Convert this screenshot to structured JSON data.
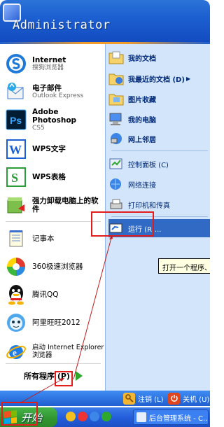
{
  "header": {
    "user_name": "Administrator"
  },
  "left_items": [
    {
      "title": "Internet",
      "subtitle": "搜狗浏览器",
      "icon": "sogou-browser-icon"
    },
    {
      "title": "电子邮件",
      "subtitle": "Outlook Express",
      "icon": "outlook-express-icon"
    },
    {
      "title": "Adobe Photoshop",
      "subtitle": "CS5",
      "icon": "photoshop-icon"
    },
    {
      "title": "WPS文字",
      "subtitle": "",
      "icon": "wps-writer-icon"
    },
    {
      "title": "WPS表格",
      "subtitle": "",
      "icon": "wps-spreadsheet-icon"
    },
    {
      "title": "强力卸载电脑上的软件",
      "subtitle": "",
      "icon": "uninstaller-icon"
    },
    {
      "title": "记事本",
      "subtitle": "",
      "icon": "notepad-icon"
    },
    {
      "title": "360极速浏览器",
      "subtitle": "",
      "icon": "360-browser-icon"
    },
    {
      "title": "腾讯QQ",
      "subtitle": "",
      "icon": "qq-icon"
    },
    {
      "title": "阿里旺旺2012",
      "subtitle": "",
      "icon": "aliwangwang-icon"
    },
    {
      "title": "启动 Internet Explorer 浏览器",
      "subtitle": "",
      "icon": "internet-explorer-icon"
    }
  ],
  "all_programs": {
    "label": "所有程序 (P)"
  },
  "right_items": [
    {
      "label": "我的文档",
      "icon": "my-documents-icon"
    },
    {
      "label": "我最近的文档 (D)",
      "icon": "recent-documents-icon"
    },
    {
      "label": "图片收藏",
      "icon": "my-pictures-icon"
    },
    {
      "label": "我的电脑",
      "icon": "my-computer-icon"
    },
    {
      "label": "网上邻居",
      "icon": "network-places-icon"
    },
    {
      "label": "控制面板 (C)",
      "icon": "control-panel-icon"
    },
    {
      "label": "网络连接",
      "icon": "network-connections-icon"
    },
    {
      "label": "打印机和传真",
      "icon": "printers-icon"
    },
    {
      "label": "运行 (R)...",
      "icon": "run-icon"
    }
  ],
  "tooltip": {
    "text": "打开一个程序、文"
  },
  "bottom": {
    "logoff_label": "注销 (L)",
    "shutdown_label": "关机 (U)"
  },
  "taskbar": {
    "start_label": "开始",
    "task_label": "后台管理系统 - C..."
  }
}
